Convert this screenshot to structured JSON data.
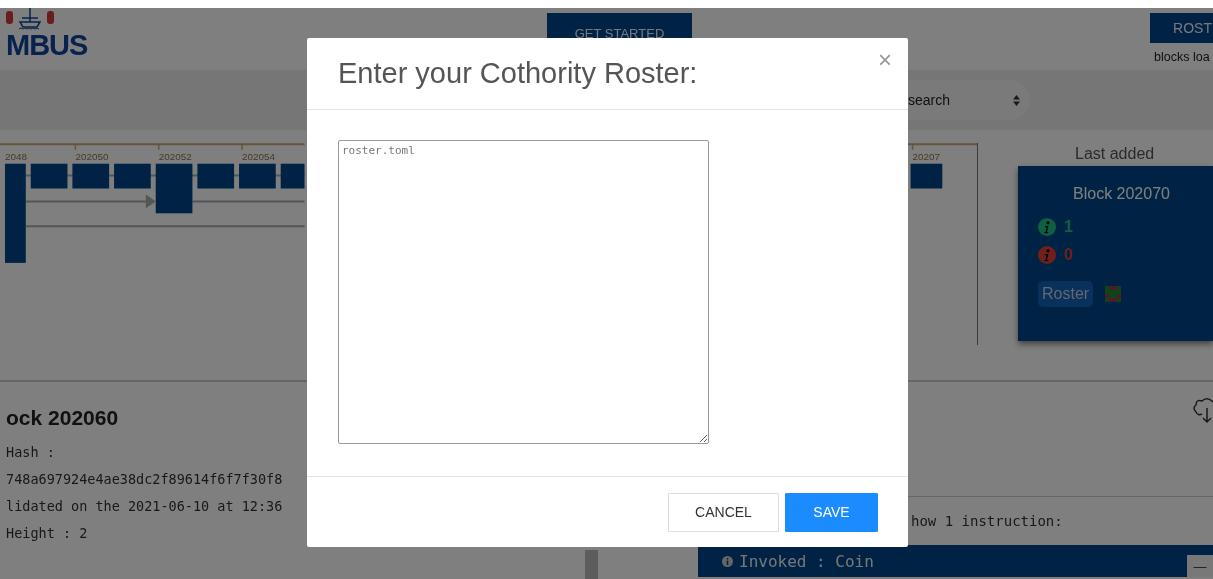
{
  "header": {
    "logo_text": "MBUS",
    "get_started": "GET STARTED",
    "roster_button": "ROST",
    "status": "blocks loa"
  },
  "search": {
    "value": "search"
  },
  "timeline": {
    "ticks": [
      {
        "label": "2048"
      },
      {
        "label": "202050"
      },
      {
        "label": "202052"
      },
      {
        "label": "202054"
      },
      {
        "label": "20207"
      }
    ]
  },
  "last_added": {
    "heading": "Last added",
    "title": "Block 202070",
    "valid_count": "1",
    "invalid_count": "0",
    "roster": "Roster"
  },
  "block_details": {
    "title": "ock 202060",
    "lines": [
      "Hash :",
      "748a697924e4ae38dc2f89614f6f7f30f8",
      "lidated on the 2021-06-10 at 12:36",
      "Height : 2"
    ]
  },
  "transactions": {
    "summary": "how 1 instruction:",
    "instruction": "Invoked : Coin",
    "collapse": "—"
  },
  "modal": {
    "title": "Enter your Cothority Roster:",
    "close": "×",
    "textarea": {
      "placeholder": "roster.toml"
    },
    "buttons": [
      {
        "label": "CANCEL",
        "kind": "secondary"
      },
      {
        "label": "SAVE",
        "kind": "primary"
      }
    ]
  }
}
